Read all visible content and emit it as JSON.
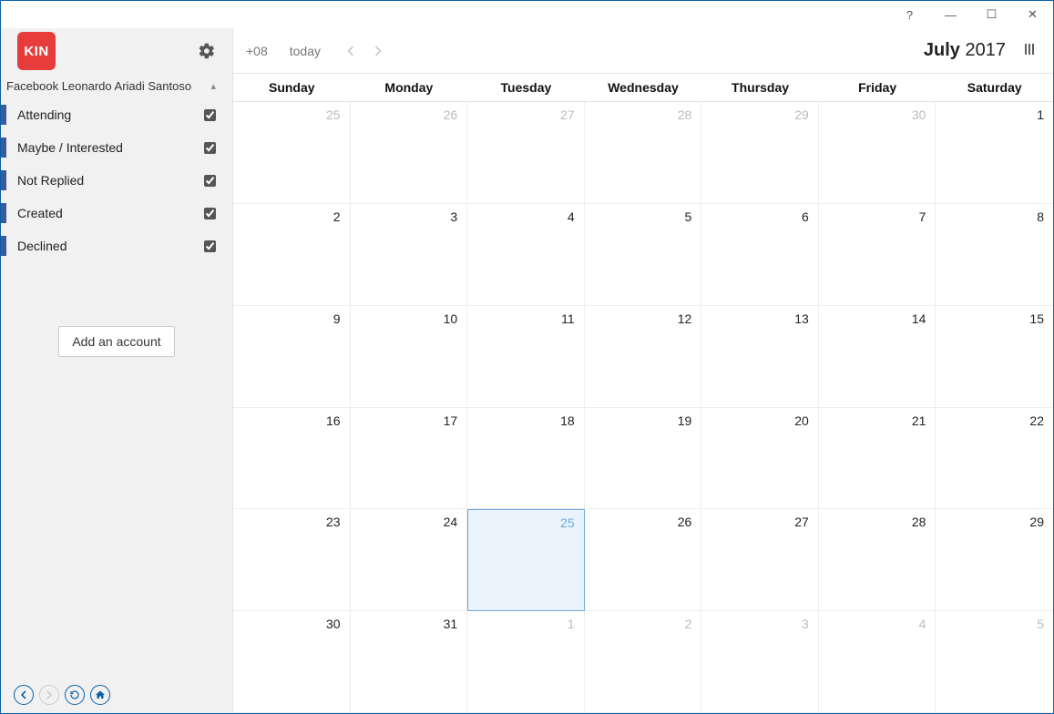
{
  "window": {
    "help": "?",
    "minimize": "—",
    "maximize": "☐",
    "close": "✕"
  },
  "sidebar": {
    "logo": "KIN",
    "account_name": "Facebook Leonardo Ariadi Santoso",
    "filters": [
      {
        "label": "Attending"
      },
      {
        "label": "Maybe / Interested"
      },
      {
        "label": "Not Replied"
      },
      {
        "label": "Created"
      },
      {
        "label": "Declined"
      }
    ],
    "add_account_label": "Add an account"
  },
  "toolbar": {
    "tz": "+08",
    "today_label": "today",
    "month": "July",
    "year": "2017"
  },
  "dow": [
    "Sunday",
    "Monday",
    "Tuesday",
    "Wednesday",
    "Thursday",
    "Friday",
    "Saturday"
  ],
  "cells": [
    {
      "n": "25",
      "muted": true
    },
    {
      "n": "26",
      "muted": true
    },
    {
      "n": "27",
      "muted": true
    },
    {
      "n": "28",
      "muted": true
    },
    {
      "n": "29",
      "muted": true
    },
    {
      "n": "30",
      "muted": true
    },
    {
      "n": "1"
    },
    {
      "n": "2"
    },
    {
      "n": "3"
    },
    {
      "n": "4"
    },
    {
      "n": "5"
    },
    {
      "n": "6"
    },
    {
      "n": "7"
    },
    {
      "n": "8"
    },
    {
      "n": "9"
    },
    {
      "n": "10"
    },
    {
      "n": "11"
    },
    {
      "n": "12"
    },
    {
      "n": "13"
    },
    {
      "n": "14"
    },
    {
      "n": "15"
    },
    {
      "n": "16"
    },
    {
      "n": "17"
    },
    {
      "n": "18"
    },
    {
      "n": "19"
    },
    {
      "n": "20"
    },
    {
      "n": "21"
    },
    {
      "n": "22"
    },
    {
      "n": "23"
    },
    {
      "n": "24"
    },
    {
      "n": "25",
      "today": true
    },
    {
      "n": "26"
    },
    {
      "n": "27"
    },
    {
      "n": "28"
    },
    {
      "n": "29"
    },
    {
      "n": "30"
    },
    {
      "n": "31"
    },
    {
      "n": "1",
      "muted": true
    },
    {
      "n": "2",
      "muted": true
    },
    {
      "n": "3",
      "muted": true
    },
    {
      "n": "4",
      "muted": true
    },
    {
      "n": "5",
      "muted": true
    }
  ]
}
